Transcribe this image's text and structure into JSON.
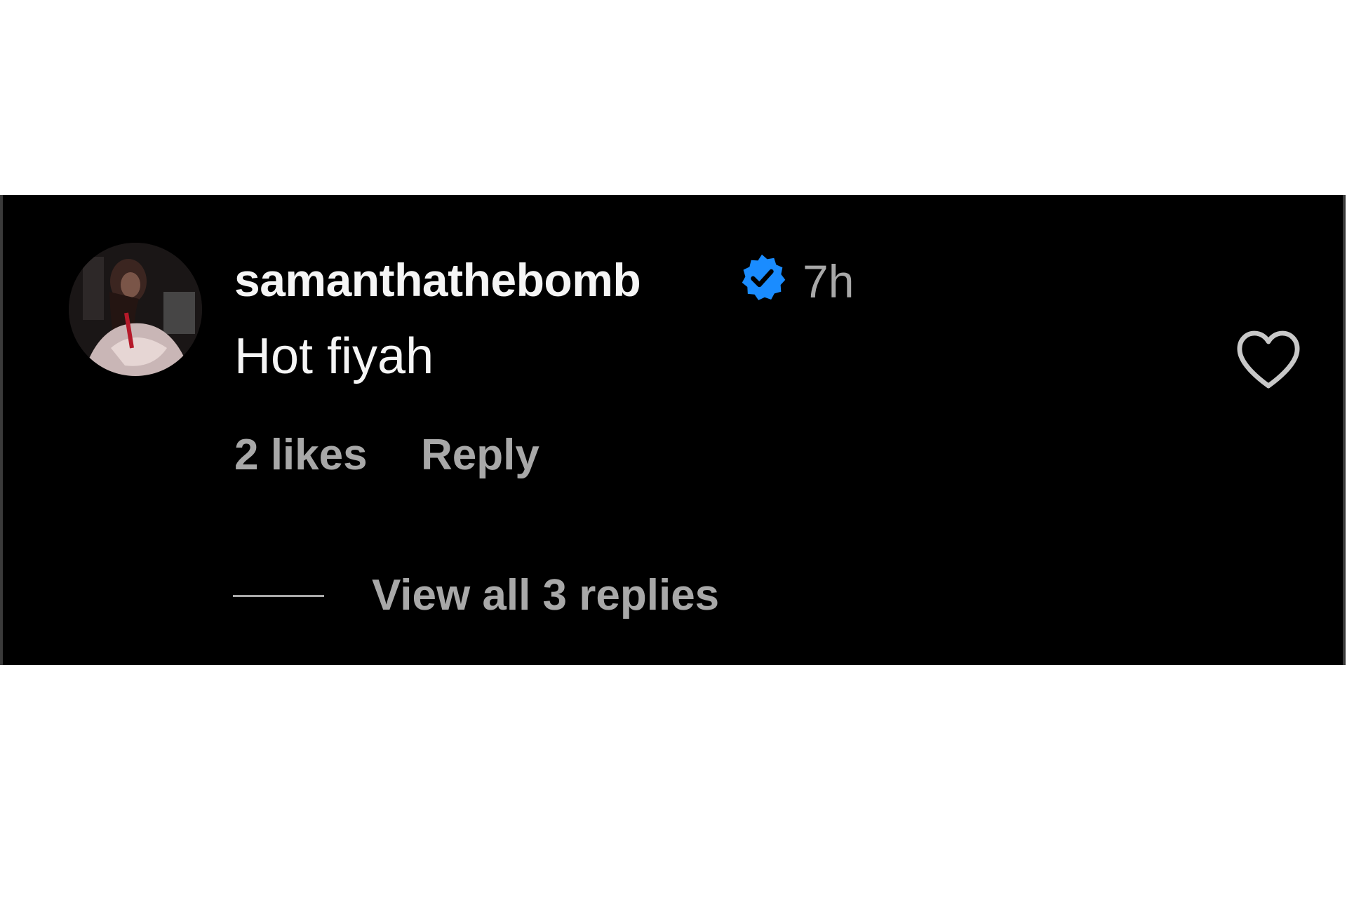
{
  "comment": {
    "username": "samanthathebomb",
    "verified": true,
    "timestamp": "7h",
    "text": "Hot fiyah",
    "likes_label": "2 likes",
    "reply_label": "Reply",
    "view_replies_label": "View all 3 replies"
  },
  "icons": {
    "avatar": "profile-avatar",
    "verified": "verified-badge-icon",
    "like": "heart-outline-icon"
  },
  "colors": {
    "background": "#000000",
    "primary_text": "#f5f5f5",
    "secondary_text": "#a8a8a8",
    "verified_blue": "#0095f6"
  }
}
